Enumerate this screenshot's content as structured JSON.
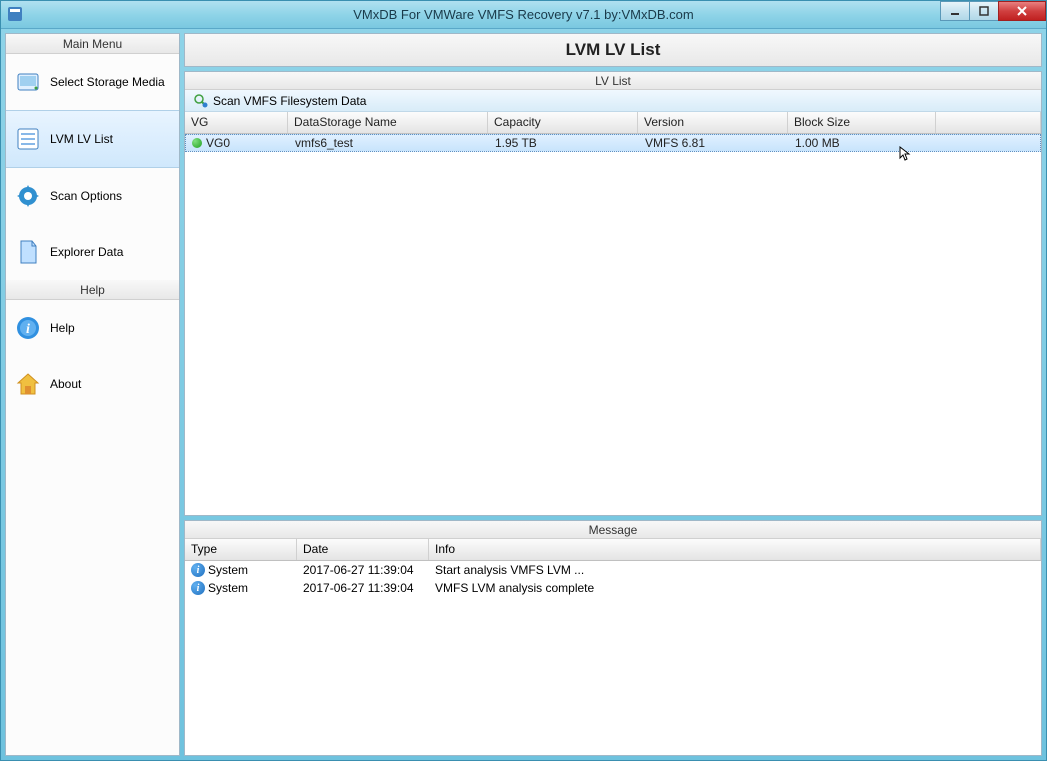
{
  "window": {
    "title": "VMxDB For VMWare VMFS Recovery v7.1 by:VMxDB.com"
  },
  "sidebar": {
    "headers": {
      "main": "Main Menu",
      "help": "Help"
    },
    "items": [
      {
        "label": "Select Storage Media"
      },
      {
        "label": "LVM LV List"
      },
      {
        "label": "Scan Options"
      },
      {
        "label": "Explorer Data"
      }
    ],
    "helpItems": [
      {
        "label": "Help"
      },
      {
        "label": "About"
      }
    ]
  },
  "page": {
    "title": "LVM LV List"
  },
  "lvPanel": {
    "title": "LV List",
    "toolbar": {
      "scan": "Scan VMFS Filesystem Data"
    },
    "columns": {
      "vg": "VG",
      "ds": "DataStorage Name",
      "cap": "Capacity",
      "ver": "Version",
      "bs": "Block Size"
    },
    "rows": [
      {
        "vg": "VG0",
        "ds": "vmfs6_test",
        "cap": "1.95 TB",
        "ver": "VMFS 6.81",
        "bs": "1.00 MB"
      }
    ]
  },
  "messagePanel": {
    "title": "Message",
    "columns": {
      "type": "Type",
      "date": "Date",
      "info": "Info"
    },
    "rows": [
      {
        "type": "System",
        "date": "2017-06-27 11:39:04",
        "info": "Start analysis VMFS LVM ..."
      },
      {
        "type": "System",
        "date": "2017-06-27 11:39:04",
        "info": "VMFS LVM analysis complete"
      }
    ]
  }
}
